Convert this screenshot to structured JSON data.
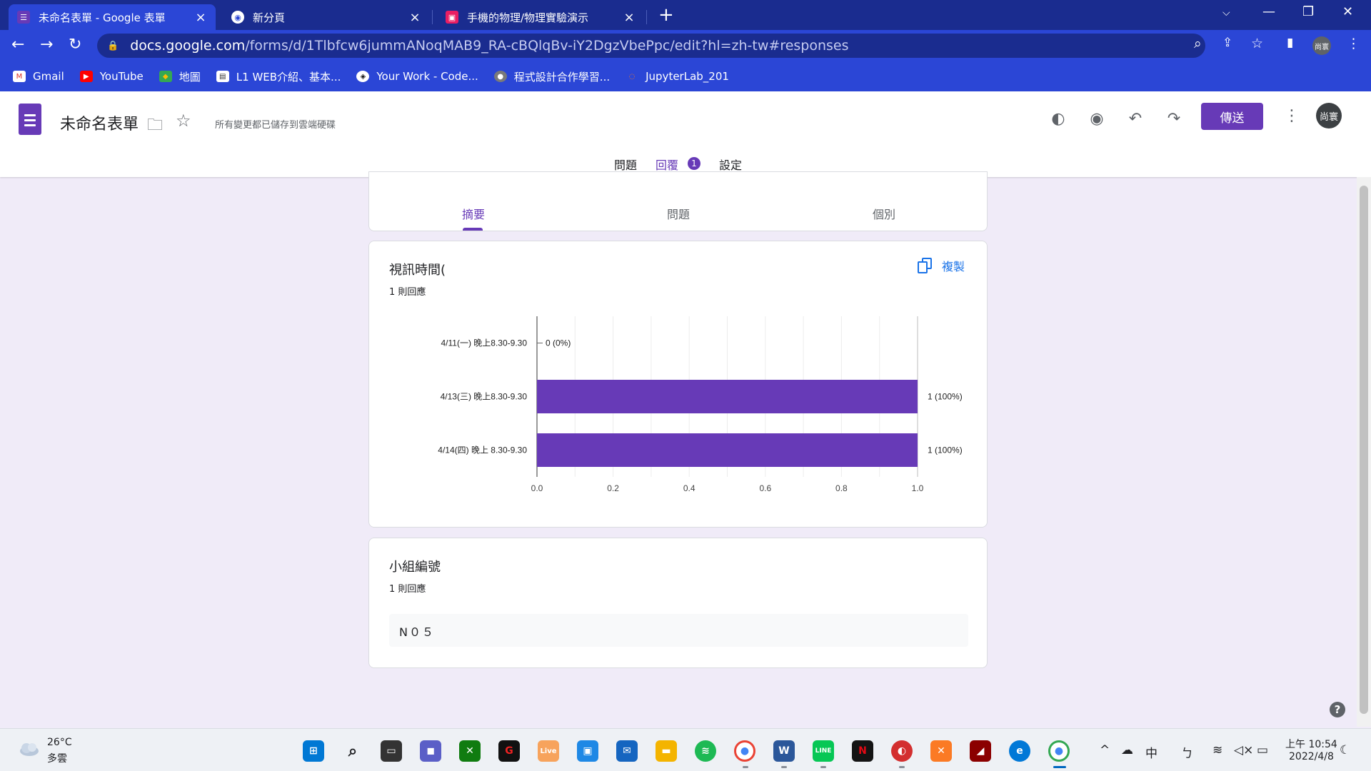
{
  "browser": {
    "tabs": [
      {
        "title": "未命名表單 - Google 表單",
        "active": true
      },
      {
        "title": "新分頁",
        "active": false
      },
      {
        "title": "手機的物理/物理實驗演示",
        "active": false
      }
    ],
    "url_host": "docs.google.com",
    "url_path": "/forms/d/1Tlbfcw6jummANoqMAB9_RA-cBQlqBv-iY2DgzVbePpc/edit?hl=zh-tw#responses",
    "profile_label": "尚寰",
    "bookmarks": [
      "Gmail",
      "YouTube",
      "地圖",
      "L1 WEB介紹、基本...",
      "Your Work - Code...",
      "程式設計合作學習...",
      "JupyterLab_201"
    ]
  },
  "form": {
    "title": "未命名表單",
    "save_status": "所有變更都已儲存到雲端硬碟",
    "send_label": "傳送",
    "avatar_label": "尚寰",
    "tabs": {
      "questions": "問題",
      "responses": "回覆",
      "responses_badge": "1",
      "settings": "設定"
    },
    "subtabs": {
      "summary": "摘要",
      "question": "問題",
      "individual": "個別"
    },
    "questions": [
      {
        "title": "視訊時間(",
        "count": "1 則回應",
        "copy_label": "複製"
      },
      {
        "title": "小組編號",
        "count": "1 則回應",
        "answer": "N０５"
      }
    ]
  },
  "chart_data": {
    "type": "bar",
    "orientation": "horizontal",
    "categories": [
      "4/11(一) 晚上8.30-9.30",
      "4/13(三) 晚上8.30-9.30",
      "4/14(四) 晚上 8.30-9.30"
    ],
    "values": [
      0,
      1,
      1
    ],
    "value_labels": [
      "0 (0%)",
      "1 (100%)",
      "1 (100%)"
    ],
    "xlim": [
      0,
      1.0
    ],
    "xticks": [
      "0.0",
      "0.2",
      "0.4",
      "0.6",
      "0.8",
      "1.0"
    ],
    "grid": true,
    "color": "#673ab7"
  },
  "taskbar": {
    "temperature": "26°C",
    "weather": "多雲",
    "time": "上午 10:54",
    "date": "2022/4/8",
    "ime": "中"
  },
  "colors": {
    "accent": "#673ab7",
    "chrome_blue": "#2b46d6",
    "link": "#1a73e8"
  }
}
